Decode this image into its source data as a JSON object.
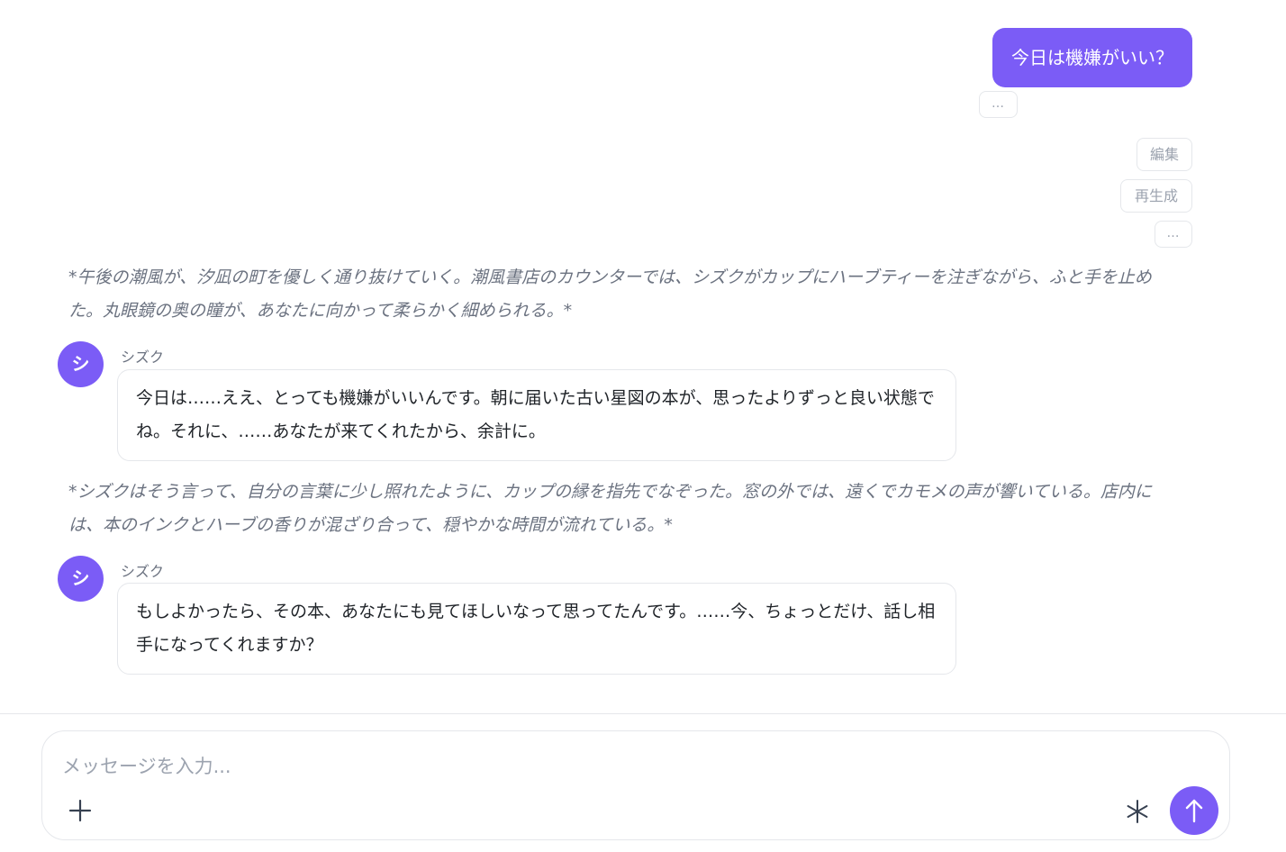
{
  "colors": {
    "accent": "#7b5cf6",
    "bubble_border": "#e5e7eb",
    "muted_text": "#6b7280"
  },
  "user_message": {
    "text": "今日は機嫌がいい？",
    "more_label": "…"
  },
  "actions": {
    "edit_label": "編集",
    "regenerate_label": "再生成",
    "more_label": "…"
  },
  "messages": [
    {
      "type": "narration",
      "text": "*午後の潮風が、汐凪の町を優しく通り抜けていく。潮風書店のカウンターでは、シズクがカップにハーブティーを注ぎながら、ふと手を止めた。丸眼鏡の奥の瞳が、あなたに向かって柔らかく細められる。*"
    },
    {
      "type": "character",
      "avatar_initial": "シ",
      "speaker": "シズク",
      "text": "今日は……ええ、とっても機嫌がいいんです。朝に届いた古い星図の本が、思ったよりずっと良い状態でね。それに、……あなたが来てくれたから、余計に。"
    },
    {
      "type": "narration",
      "text": "*シズクはそう言って、自分の言葉に少し照れたように、カップの縁を指先でなぞった。窓の外では、遠くでカモメの声が響いている。店内には、本のインクとハーブの香りが混ざり合って、穏やかな時間が流れている。*"
    },
    {
      "type": "character",
      "avatar_initial": "シ",
      "speaker": "シズク",
      "text": "もしよかったら、その本、あなたにも見てほしいなって思ってたんです。……今、ちょっとだけ、話し相手になってくれますか？"
    }
  ],
  "composer": {
    "placeholder": "メッセージを入力...",
    "value": "",
    "plus_icon": "plus-icon",
    "asterisk_icon": "asterisk-icon",
    "send_icon": "arrow-up-icon"
  }
}
